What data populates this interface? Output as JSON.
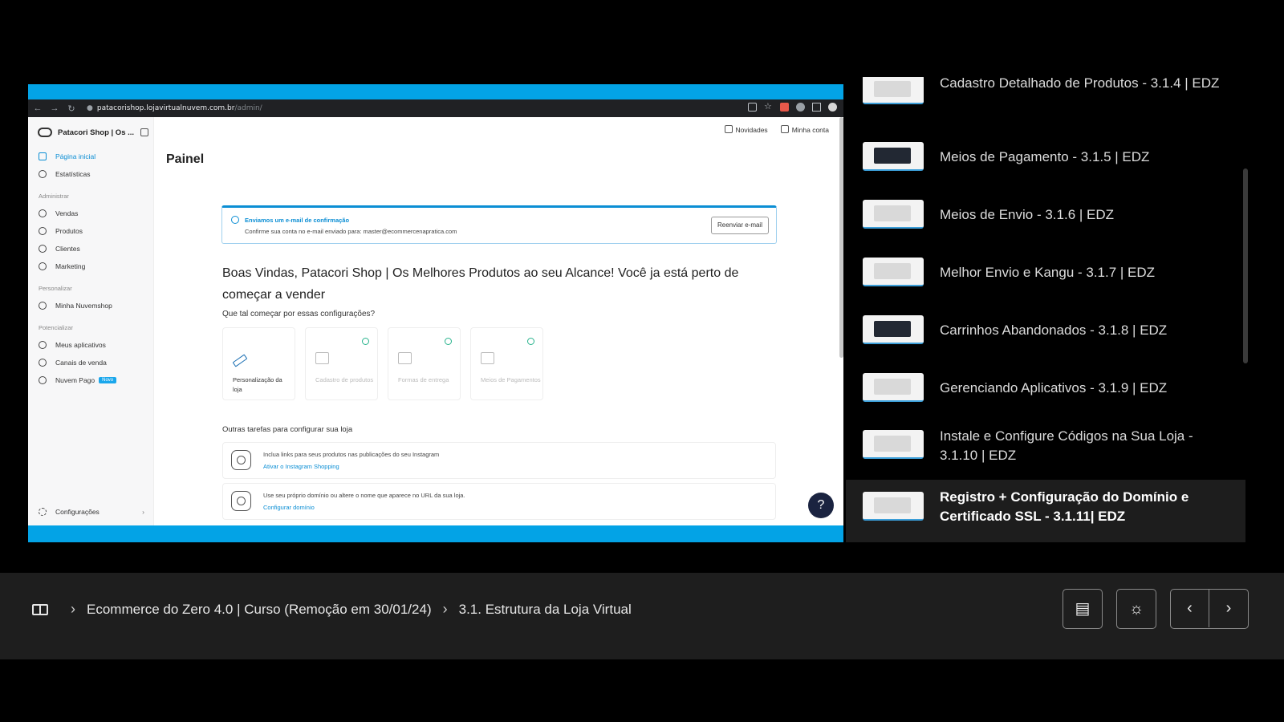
{
  "browser": {
    "url_host": "patacorishop.lojavirtualnuvem.com.br",
    "url_path": "/admin/"
  },
  "inner_app": {
    "store_name": "Patacori Shop | Os ...",
    "nav_top": [
      {
        "label": "Página inicial",
        "icon": "home-icon",
        "active": true
      },
      {
        "label": "Estatísticas",
        "icon": "chart-icon",
        "active": false
      }
    ],
    "sections": [
      {
        "title": "Administrar",
        "items": [
          {
            "label": "Vendas",
            "icon": "dollar-icon"
          },
          {
            "label": "Produtos",
            "icon": "tag-icon"
          },
          {
            "label": "Clientes",
            "icon": "users-icon"
          },
          {
            "label": "Marketing",
            "icon": "target-icon"
          }
        ]
      },
      {
        "title": "Personalizar",
        "items": [
          {
            "label": "Minha Nuvemshop",
            "icon": "brush-icon"
          }
        ]
      },
      {
        "title": "Potencializar",
        "items": [
          {
            "label": "Meus aplicativos",
            "icon": "apps-icon"
          },
          {
            "label": "Canais de venda",
            "icon": "share-icon"
          },
          {
            "label": "Nuvem Pago",
            "icon": "nuvem-icon",
            "tag": "Novo"
          }
        ]
      }
    ],
    "config_label": "Configurações",
    "top_links": [
      "Novidades",
      "Minha conta"
    ],
    "page_title": "Painel",
    "notice": {
      "title": "Enviamos um e-mail de confirmação",
      "text": "Confirme sua conta no e-mail enviado para: master@ecommercenapratica.com",
      "button": "Reenviar e-mail"
    },
    "welcome": "Boas Vindas, Patacori Shop | Os Melhores Produtos ao seu Alcance! Você ja está perto de começar a vender",
    "question": "Que tal começar por essas configurações?",
    "cards": [
      {
        "label": "Personalização da loja",
        "done": false
      },
      {
        "label": "Cadastro de produtos",
        "done": true
      },
      {
        "label": "Formas de entrega",
        "done": true
      },
      {
        "label": "Meios de Pagamentos",
        "done": true
      }
    ],
    "other_tasks_title": "Outras tarefas para configurar sua loja",
    "tasks": [
      {
        "text": "Inclua links para seus produtos nas publicações do seu Instagram",
        "link": "Ativar o Instagram Shopping",
        "icon": "instagram-icon"
      },
      {
        "text": "Use seu próprio domínio ou altere o nome que aparece no URL da sua loja.",
        "link": "Configurar domínio",
        "icon": "www-icon"
      }
    ],
    "help": "?"
  },
  "playlist": [
    {
      "title": "Cadastro Detalhado de Produtos - 3.1.4 | EDZ",
      "current": false
    },
    {
      "title": "Meios de Pagamento - 3.1.5 | EDZ",
      "current": false
    },
    {
      "title": "Meios de Envio - 3.1.6 | EDZ",
      "current": false
    },
    {
      "title": "Melhor Envio e Kangu - 3.1.7 | EDZ",
      "current": false
    },
    {
      "title": "Carrinhos Abandonados - 3.1.8 | EDZ",
      "current": false
    },
    {
      "title": "Gerenciando Aplicativos - 3.1.9 | EDZ",
      "current": false
    },
    {
      "title": "Instale e Configure Códigos na Sua Loja - 3.1.10 | EDZ",
      "current": false
    },
    {
      "title": "Registro + Configuração do Domínio e Certificado SSL - 3.1.11| EDZ",
      "current": true
    }
  ],
  "breadcrumb": {
    "course": "Ecommerce do Zero 4.0 | Curso (Remoção em 30/01/24)",
    "module": "3.1. Estrutura da Loja Virtual"
  },
  "controls": {
    "layout_icon": "layout-icon",
    "light_icon": "lightbulb-icon",
    "prev_icon": "chevron-left-icon",
    "next_icon": "chevron-right-icon"
  },
  "colors": {
    "accent": "#0b8ed4",
    "video_border": "#03a3e6",
    "bottom_bar": "#1e1e1e"
  }
}
